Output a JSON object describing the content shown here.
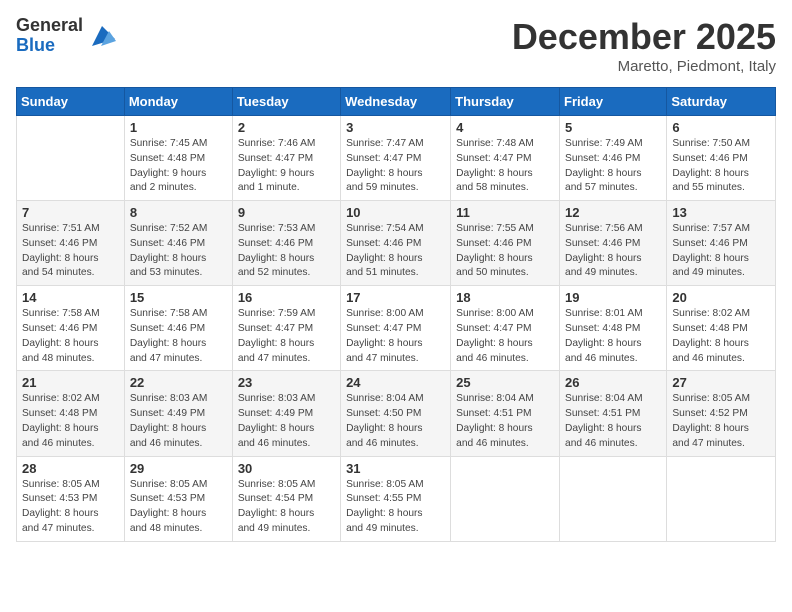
{
  "logo": {
    "general": "General",
    "blue": "Blue"
  },
  "title": "December 2025",
  "location": "Maretto, Piedmont, Italy",
  "days_of_week": [
    "Sunday",
    "Monday",
    "Tuesday",
    "Wednesday",
    "Thursday",
    "Friday",
    "Saturday"
  ],
  "weeks": [
    [
      {
        "day": "",
        "info": ""
      },
      {
        "day": "1",
        "info": "Sunrise: 7:45 AM\nSunset: 4:48 PM\nDaylight: 9 hours\nand 2 minutes."
      },
      {
        "day": "2",
        "info": "Sunrise: 7:46 AM\nSunset: 4:47 PM\nDaylight: 9 hours\nand 1 minute."
      },
      {
        "day": "3",
        "info": "Sunrise: 7:47 AM\nSunset: 4:47 PM\nDaylight: 8 hours\nand 59 minutes."
      },
      {
        "day": "4",
        "info": "Sunrise: 7:48 AM\nSunset: 4:47 PM\nDaylight: 8 hours\nand 58 minutes."
      },
      {
        "day": "5",
        "info": "Sunrise: 7:49 AM\nSunset: 4:46 PM\nDaylight: 8 hours\nand 57 minutes."
      },
      {
        "day": "6",
        "info": "Sunrise: 7:50 AM\nSunset: 4:46 PM\nDaylight: 8 hours\nand 55 minutes."
      }
    ],
    [
      {
        "day": "7",
        "info": "Sunrise: 7:51 AM\nSunset: 4:46 PM\nDaylight: 8 hours\nand 54 minutes."
      },
      {
        "day": "8",
        "info": "Sunrise: 7:52 AM\nSunset: 4:46 PM\nDaylight: 8 hours\nand 53 minutes."
      },
      {
        "day": "9",
        "info": "Sunrise: 7:53 AM\nSunset: 4:46 PM\nDaylight: 8 hours\nand 52 minutes."
      },
      {
        "day": "10",
        "info": "Sunrise: 7:54 AM\nSunset: 4:46 PM\nDaylight: 8 hours\nand 51 minutes."
      },
      {
        "day": "11",
        "info": "Sunrise: 7:55 AM\nSunset: 4:46 PM\nDaylight: 8 hours\nand 50 minutes."
      },
      {
        "day": "12",
        "info": "Sunrise: 7:56 AM\nSunset: 4:46 PM\nDaylight: 8 hours\nand 49 minutes."
      },
      {
        "day": "13",
        "info": "Sunrise: 7:57 AM\nSunset: 4:46 PM\nDaylight: 8 hours\nand 49 minutes."
      }
    ],
    [
      {
        "day": "14",
        "info": "Sunrise: 7:58 AM\nSunset: 4:46 PM\nDaylight: 8 hours\nand 48 minutes."
      },
      {
        "day": "15",
        "info": "Sunrise: 7:58 AM\nSunset: 4:46 PM\nDaylight: 8 hours\nand 47 minutes."
      },
      {
        "day": "16",
        "info": "Sunrise: 7:59 AM\nSunset: 4:47 PM\nDaylight: 8 hours\nand 47 minutes."
      },
      {
        "day": "17",
        "info": "Sunrise: 8:00 AM\nSunset: 4:47 PM\nDaylight: 8 hours\nand 47 minutes."
      },
      {
        "day": "18",
        "info": "Sunrise: 8:00 AM\nSunset: 4:47 PM\nDaylight: 8 hours\nand 46 minutes."
      },
      {
        "day": "19",
        "info": "Sunrise: 8:01 AM\nSunset: 4:48 PM\nDaylight: 8 hours\nand 46 minutes."
      },
      {
        "day": "20",
        "info": "Sunrise: 8:02 AM\nSunset: 4:48 PM\nDaylight: 8 hours\nand 46 minutes."
      }
    ],
    [
      {
        "day": "21",
        "info": "Sunrise: 8:02 AM\nSunset: 4:48 PM\nDaylight: 8 hours\nand 46 minutes."
      },
      {
        "day": "22",
        "info": "Sunrise: 8:03 AM\nSunset: 4:49 PM\nDaylight: 8 hours\nand 46 minutes."
      },
      {
        "day": "23",
        "info": "Sunrise: 8:03 AM\nSunset: 4:49 PM\nDaylight: 8 hours\nand 46 minutes."
      },
      {
        "day": "24",
        "info": "Sunrise: 8:04 AM\nSunset: 4:50 PM\nDaylight: 8 hours\nand 46 minutes."
      },
      {
        "day": "25",
        "info": "Sunrise: 8:04 AM\nSunset: 4:51 PM\nDaylight: 8 hours\nand 46 minutes."
      },
      {
        "day": "26",
        "info": "Sunrise: 8:04 AM\nSunset: 4:51 PM\nDaylight: 8 hours\nand 46 minutes."
      },
      {
        "day": "27",
        "info": "Sunrise: 8:05 AM\nSunset: 4:52 PM\nDaylight: 8 hours\nand 47 minutes."
      }
    ],
    [
      {
        "day": "28",
        "info": "Sunrise: 8:05 AM\nSunset: 4:53 PM\nDaylight: 8 hours\nand 47 minutes."
      },
      {
        "day": "29",
        "info": "Sunrise: 8:05 AM\nSunset: 4:53 PM\nDaylight: 8 hours\nand 48 minutes."
      },
      {
        "day": "30",
        "info": "Sunrise: 8:05 AM\nSunset: 4:54 PM\nDaylight: 8 hours\nand 49 minutes."
      },
      {
        "day": "31",
        "info": "Sunrise: 8:05 AM\nSunset: 4:55 PM\nDaylight: 8 hours\nand 49 minutes."
      },
      {
        "day": "",
        "info": ""
      },
      {
        "day": "",
        "info": ""
      },
      {
        "day": "",
        "info": ""
      }
    ]
  ]
}
